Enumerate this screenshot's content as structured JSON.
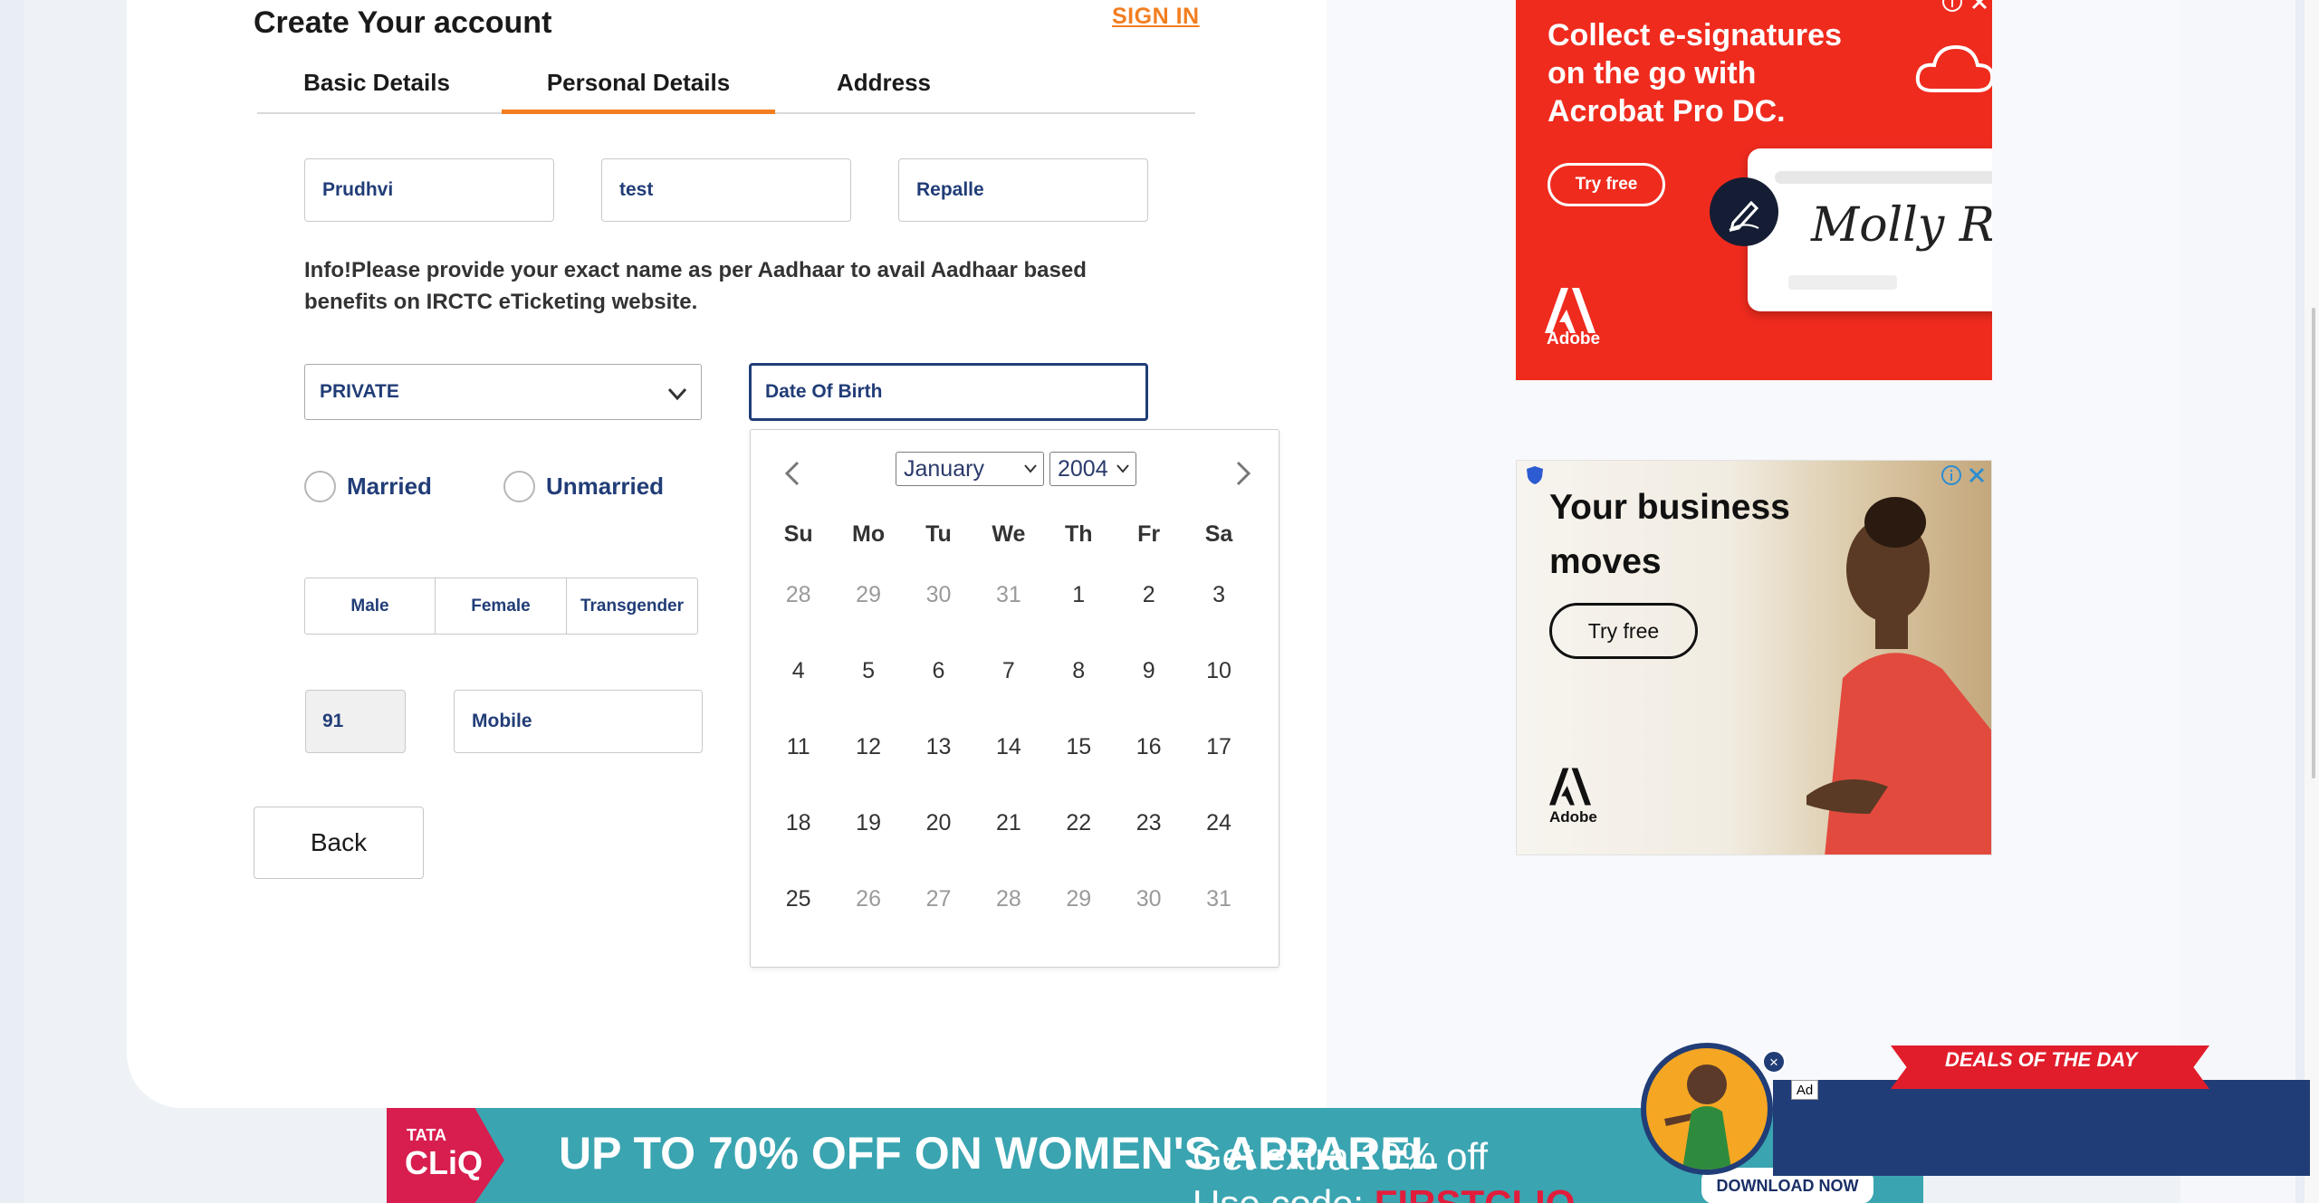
{
  "header": {
    "title": "Create Your account",
    "sign_in": "SIGN IN"
  },
  "tabs": [
    {
      "label": "Basic Details",
      "active": false
    },
    {
      "label": "Personal Details",
      "active": true
    },
    {
      "label": "Address",
      "active": false
    }
  ],
  "name_fields": {
    "first": "Prudhvi",
    "middle": "test",
    "last": "Repalle"
  },
  "info_text": "Info!Please provide your exact name as per Aadhaar to avail Aadhaar based benefits on IRCTC eTicketing website.",
  "occupation": {
    "value": "PRIVATE"
  },
  "dob": {
    "placeholder": "Date Of Birth"
  },
  "marital": {
    "married": "Married",
    "unmarried": "Unmarried"
  },
  "gender": {
    "male": "Male",
    "female": "Female",
    "transgender": "Transgender"
  },
  "phone": {
    "country_code": "91",
    "mobile_placeholder": "Mobile"
  },
  "back_label": "Back",
  "calendar": {
    "month": "January",
    "year": "2004",
    "weekdays": [
      "Su",
      "Mo",
      "Tu",
      "We",
      "Th",
      "Fr",
      "Sa"
    ],
    "weeks": [
      [
        "28",
        "29",
        "30",
        "31",
        "1",
        "2",
        "3"
      ],
      [
        "4",
        "5",
        "6",
        "7",
        "8",
        "9",
        "10"
      ],
      [
        "11",
        "12",
        "13",
        "14",
        "15",
        "16",
        "17"
      ],
      [
        "18",
        "19",
        "20",
        "21",
        "22",
        "23",
        "24"
      ],
      [
        "25",
        "26",
        "27",
        "28",
        "29",
        "30",
        "31"
      ]
    ],
    "faded": [
      [
        true,
        true,
        true,
        true,
        false,
        false,
        false
      ],
      [
        false,
        false,
        false,
        false,
        false,
        false,
        false
      ],
      [
        false,
        false,
        false,
        false,
        false,
        false,
        false
      ],
      [
        false,
        false,
        false,
        false,
        false,
        false,
        false
      ],
      [
        false,
        true,
        true,
        true,
        true,
        true,
        true
      ]
    ]
  },
  "ads": {
    "acrobat": {
      "headline": "Collect e-signatures on the go with Acrobat Pro DC.",
      "button": "Try free",
      "brand": "Adobe",
      "signature": "Molly R"
    },
    "business": {
      "headline_line1": "Your business",
      "headline_line2": "moves",
      "button": "Try free",
      "brand": "Adobe"
    },
    "bottom": {
      "brand_top": "TATA",
      "brand_bottom": "CLiQ",
      "headline": "UP TO 70% OFF ON WOMEN'S APPAREL",
      "offer": "Get extra 10% off",
      "code_prefix": "Use code: ",
      "code": "FIRSTCLIQ",
      "download": "DOWNLOAD NOW"
    },
    "deals": {
      "label": "DEALS OF THE DAY",
      "ad_tag": "Ad"
    }
  },
  "colors": {
    "accent": "#f37e20",
    "navy": "#213d77",
    "adobe_red": "#ef2b1e"
  }
}
